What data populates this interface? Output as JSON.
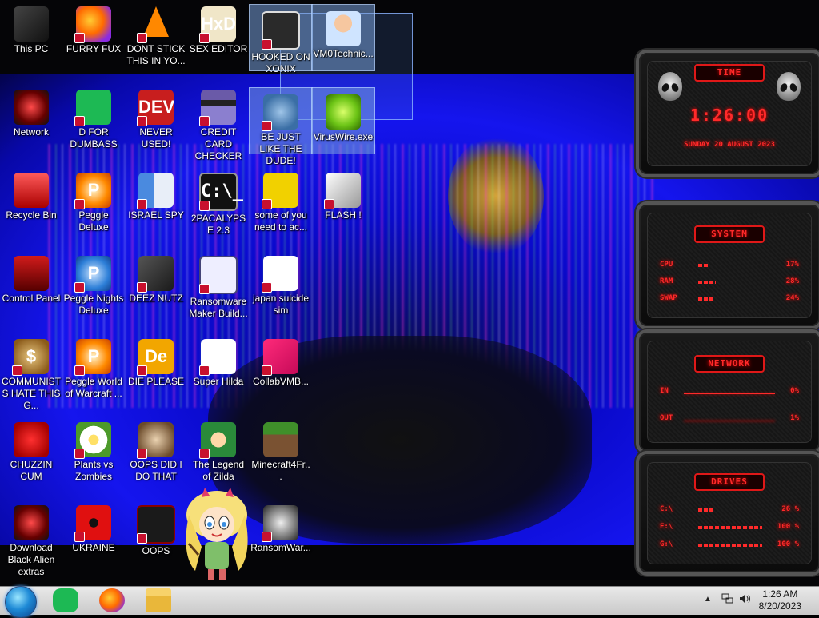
{
  "desktop": {
    "icons": [
      {
        "label": "This PC"
      },
      {
        "label": "FURRY FUX"
      },
      {
        "label": "DONT STICK THIS IN YO..."
      },
      {
        "label": "SEX EDITOR"
      },
      {
        "label": "HOOKED ON XONIX"
      },
      {
        "label": "VM0Technic..."
      },
      {
        "label": "Network"
      },
      {
        "label": "D FOR DUMBASS"
      },
      {
        "label": "NEVER USED!"
      },
      {
        "label": "CREDIT CARD CHECKER"
      },
      {
        "label": "BE JUST LIKE THE DUDE!"
      },
      {
        "label": "VirusWire.exe"
      },
      {
        "label": "Recycle Bin"
      },
      {
        "label": "Peggle Deluxe"
      },
      {
        "label": "ISRAEL SPY"
      },
      {
        "label": "2PACALYPSE 2.3"
      },
      {
        "label": "some of you need to ac..."
      },
      {
        "label": "FLASH !"
      },
      {
        "label": "Control Panel"
      },
      {
        "label": "Peggle Nights Deluxe"
      },
      {
        "label": "DEEZ NUTZ"
      },
      {
        "label": "Ransomware Maker Build..."
      },
      {
        "label": "japan suicide sim"
      },
      {
        "label": "COMMUNISTS HATE THIS G..."
      },
      {
        "label": "Peggle World of Warcraft ..."
      },
      {
        "label": "DIE PLEASE"
      },
      {
        "label": "Super Hilda"
      },
      {
        "label": "CollabVMB..."
      },
      {
        "label": "CHUZZIN CUM"
      },
      {
        "label": "Plants vs Zombies"
      },
      {
        "label": "OOPS DID I DO THAT"
      },
      {
        "label": "The Legend of Zilda"
      },
      {
        "label": "Minecraft4Fr..."
      },
      {
        "label": "Download Black Alien extras"
      },
      {
        "label": "UKRAINE"
      },
      {
        "label": "OOPS"
      },
      {
        "label": "RansomWar..."
      }
    ],
    "glyph_text": {
      "dev": "DEV",
      "hxd": "HxD",
      "cmd": "C:\\_",
      "de": "De",
      "peggle": "P",
      "money": "$"
    }
  },
  "widgets": {
    "time": {
      "title": "TIME",
      "clock": "1:26:00",
      "date": "SUNDAY 20 AUGUST 2023"
    },
    "system": {
      "title": "SYSTEM",
      "rows": [
        {
          "label": "CPU",
          "value": "17%",
          "pct": 17
        },
        {
          "label": "RAM",
          "value": "28%",
          "pct": 28
        },
        {
          "label": "SWAP",
          "value": "24%",
          "pct": 24
        }
      ]
    },
    "network": {
      "title": "NETWORK",
      "rows": [
        {
          "label": "IN",
          "value": "0%"
        },
        {
          "label": "OUT",
          "value": "1%"
        }
      ]
    },
    "drives": {
      "title": "DRIVES",
      "rows": [
        {
          "label": "C:\\",
          "value": "26 %",
          "pct": 26
        },
        {
          "label": "F:\\",
          "value": "100 %",
          "pct": 100
        },
        {
          "label": "G:\\",
          "value": "100 %",
          "pct": 100
        }
      ]
    }
  },
  "taskbar": {
    "clock_time": "1:26 AM",
    "clock_date": "8/20/2023",
    "tray_chevron": "▲"
  },
  "colors": {
    "accent_red": "#ff2a2a",
    "wallpaper_blue": "#1515ee",
    "taskbar": "#d9d9d9"
  }
}
